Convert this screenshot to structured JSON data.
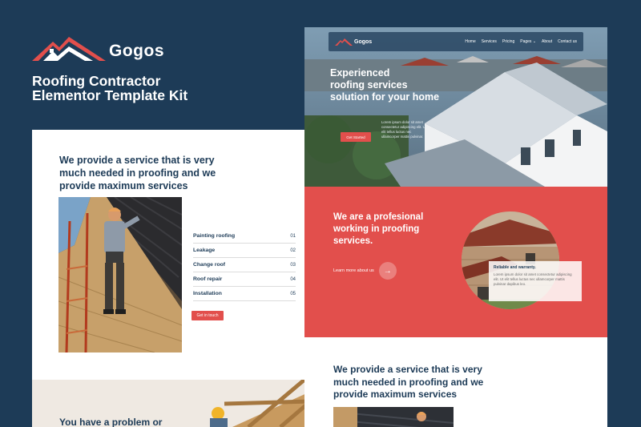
{
  "brand": {
    "name": "Gogos"
  },
  "tagline": [
    "Roofing Contractor",
    "Elementor Template Kit"
  ],
  "card": {
    "heading": "We provide a service that is very much needed in proofing and we provide maximum services",
    "services": [
      {
        "label": "Painting roofing",
        "num": "01"
      },
      {
        "label": "Leakage",
        "num": "02"
      },
      {
        "label": "Change roof",
        "num": "03"
      },
      {
        "label": "Roof repair",
        "num": "04"
      },
      {
        "label": "Installation",
        "num": "05"
      }
    ],
    "button": "Get in touch"
  },
  "strip": {
    "text": "You have a problem or"
  },
  "site": {
    "nav": {
      "brand": "Gogos",
      "links": [
        "Home",
        "Services",
        "Pricing",
        "Pages",
        "About",
        "Contact us"
      ]
    },
    "hero": {
      "title": [
        "Experienced",
        "roofing services",
        "solution for your home"
      ],
      "body": "Lorem ipsum dolor sit amet consectetur adipiscing elit. Ut elit tellus luctus nec ullamcorper mattis pulvinar.",
      "button": "Get Started"
    },
    "about": {
      "title": [
        "We are a profesional",
        "working in proofing",
        "services."
      ],
      "learn": "Learn more about us",
      "warranty_title": "Reliable and warranty.",
      "warranty_body": "Lorem ipsum dolor sit amet consectetur adipiscing elit. Ut elit tellus luctus nec ullamcorper mattis pulvinar dapibus leo."
    },
    "services": {
      "title": [
        "We provide a service that is very",
        "much needed in proofing and we",
        "provide maximum services"
      ]
    }
  },
  "colors": {
    "navy": "#1d3b57",
    "accent": "#e24f4c",
    "white": "#ffffff"
  }
}
